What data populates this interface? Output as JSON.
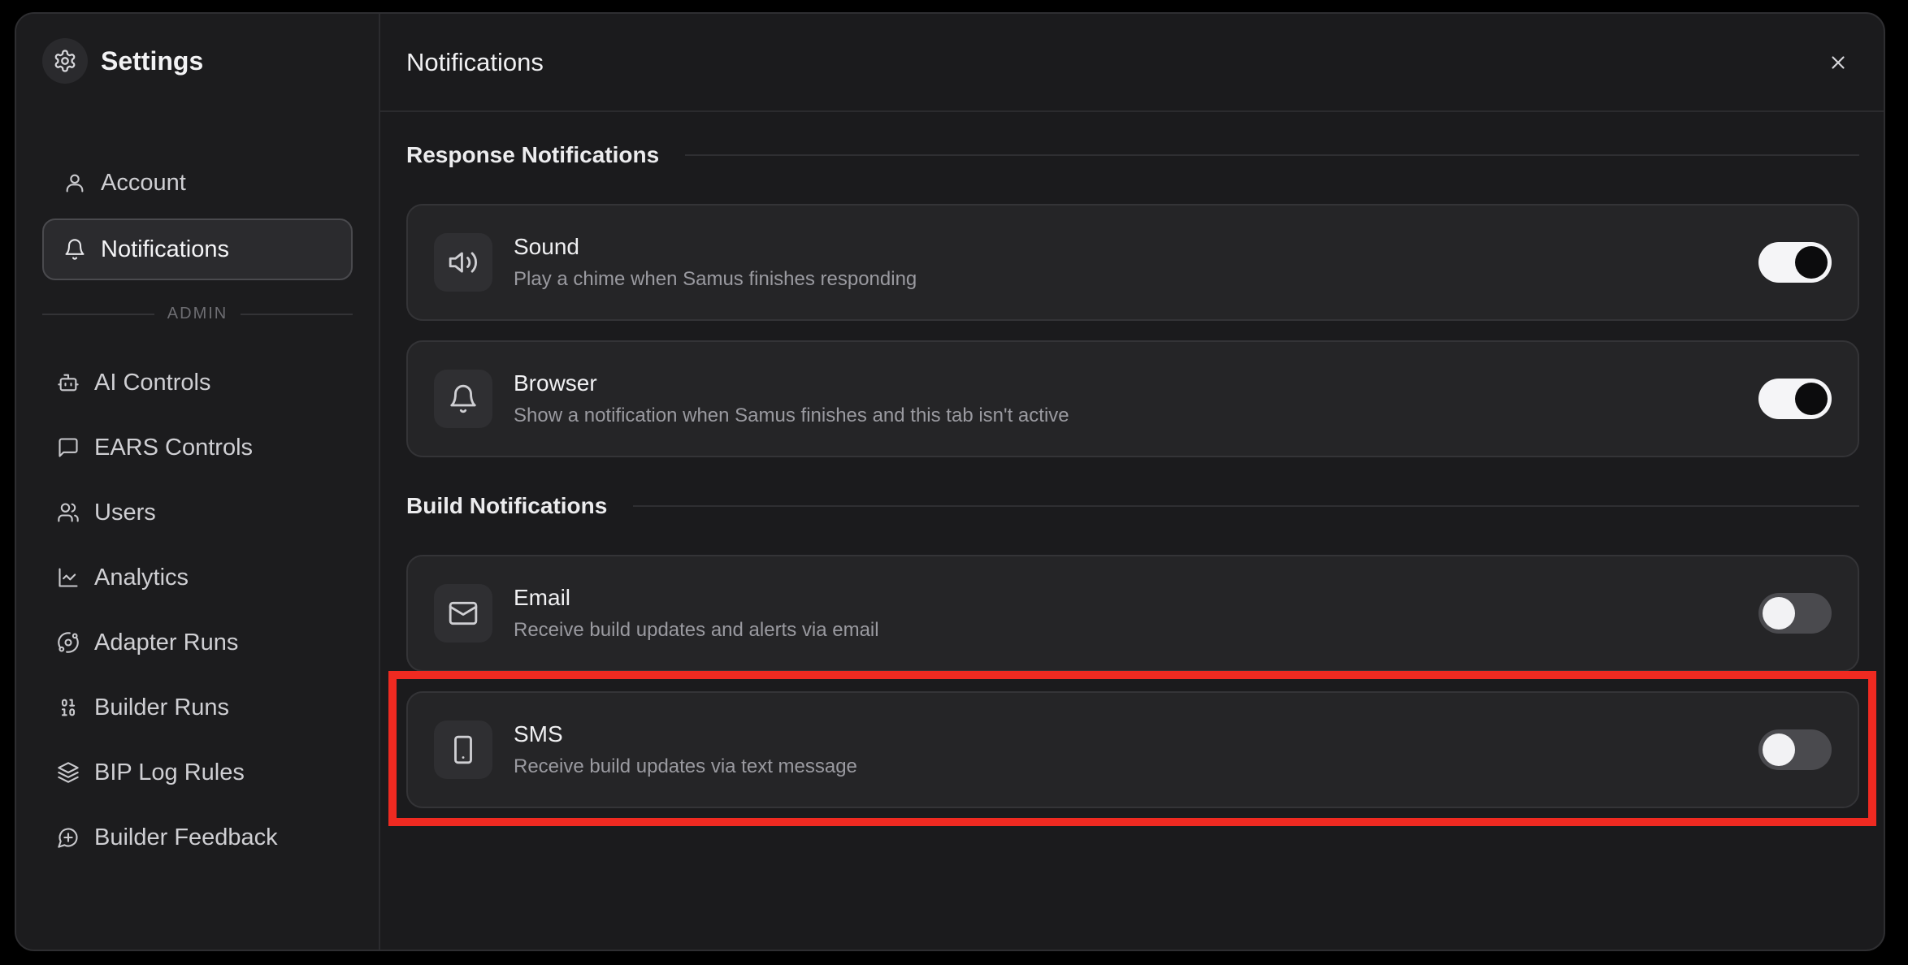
{
  "sidebar": {
    "title": "Settings",
    "items": [
      {
        "label": "Account",
        "icon": "user-icon"
      },
      {
        "label": "Notifications",
        "icon": "bell-icon",
        "active": true
      }
    ],
    "admin_label": "ADMIN",
    "admin_items": [
      {
        "label": "AI Controls",
        "icon": "bot-icon"
      },
      {
        "label": "EARS Controls",
        "icon": "message-square-icon"
      },
      {
        "label": "Users",
        "icon": "users-icon"
      },
      {
        "label": "Analytics",
        "icon": "chart-line-icon"
      },
      {
        "label": "Adapter Runs",
        "icon": "orbit-icon"
      },
      {
        "label": "Builder Runs",
        "icon": "binary-icon"
      },
      {
        "label": "BIP Log Rules",
        "icon": "layers-icon"
      },
      {
        "label": "Builder Feedback",
        "icon": "message-plus-icon"
      }
    ]
  },
  "header": {
    "title": "Notifications"
  },
  "sections": {
    "response": {
      "title": "Response Notifications",
      "cards": [
        {
          "title": "Sound",
          "description": "Play a chime when Samus finishes responding",
          "enabled": true
        },
        {
          "title": "Browser",
          "description": "Show a notification when Samus finishes and this tab isn't active",
          "enabled": true
        }
      ]
    },
    "build": {
      "title": "Build Notifications",
      "cards": [
        {
          "title": "Email",
          "description": "Receive build updates and alerts via email",
          "enabled": false
        },
        {
          "title": "SMS",
          "description": "Receive build updates via text message",
          "enabled": false
        }
      ]
    }
  },
  "colors": {
    "highlight": "#ef2a21",
    "background": "#1b1b1d"
  }
}
